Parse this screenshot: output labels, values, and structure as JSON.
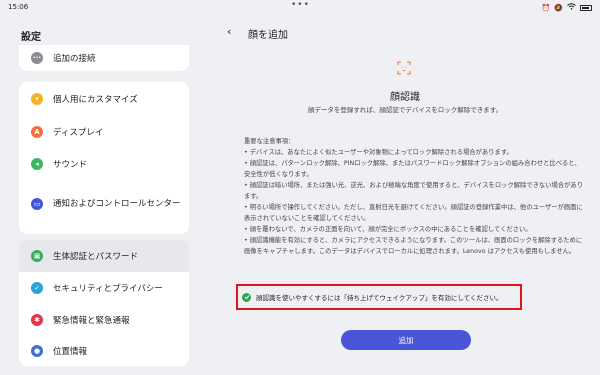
{
  "statusbar": {
    "time": "15:06",
    "dots": "•••",
    "icons": [
      "alarm-icon",
      "mute-icon",
      "wifi-icon",
      "battery-icon"
    ]
  },
  "sidebar": {
    "title": "設定",
    "items": [
      {
        "label": "追加の接続",
        "icon": "more-icon",
        "color": "#8b8d94"
      },
      {
        "label": "個人用にカスタマイズ",
        "icon": "palette-icon",
        "color": "#f3b322"
      },
      {
        "label": "ディスプレイ",
        "icon": "display-icon",
        "color": "#f2703a"
      },
      {
        "label": "サウンド",
        "icon": "sound-icon",
        "color": "#3bb561"
      },
      {
        "label": "通知およびコントロールセンター",
        "icon": "notification-icon",
        "color": "#4356d6"
      },
      {
        "label": "生体認証とパスワード",
        "icon": "lock-icon",
        "color": "#33b05c"
      },
      {
        "label": "セキュリティとプライバシー",
        "icon": "shield-icon",
        "color": "#2aa1d9"
      },
      {
        "label": "緊急情報と緊急通報",
        "icon": "emergency-icon",
        "color": "#e5334a"
      },
      {
        "label": "位置情報",
        "icon": "location-icon",
        "color": "#3f6fd8"
      }
    ]
  },
  "main": {
    "back_icon": "‹",
    "title": "顔を追加",
    "feature_title": "顔認識",
    "feature_desc": "顔データを登録すれば、顔認証でデバイスをロック解除できます。",
    "notes": [
      "重要な注意事項：",
      "• デバイスは、あなたによく似たユーザーや対象物によってロック解除される場合があります。",
      "• 顔認証は、パターンロック解除、PINロック解除、またはパスワードロック解除オプションの組み合わせと比べると、安全性が低くなります。",
      "• 顔認証は暗い場所、または強い光、逆光、および極端な角度で使用すると、デバイスをロック解除できない場合があります。",
      "• 明るい場所で操作してください。ただし、直射日光を避けてください。顔認証の登録作業中は、他のユーザーが画面に表示されていないことを確認してください。",
      "• 顔を覆わないで、カメラの正面を向いて、顔が完全にボックスの中にあることを確認してください。",
      "• 顔認識機能を有効にすると、カメラにアクセスできるようになります。このツールは、画面のロックを解除するために画像をキャプチャします。このデータはデバイスでローカルに処理されます。Lenovo はアクセスも使用もしません。"
    ],
    "notice": "顔認識を使いやすくするには「持ち上げてウェイクアップ」を有効にしてください。",
    "add_button": "追加"
  }
}
